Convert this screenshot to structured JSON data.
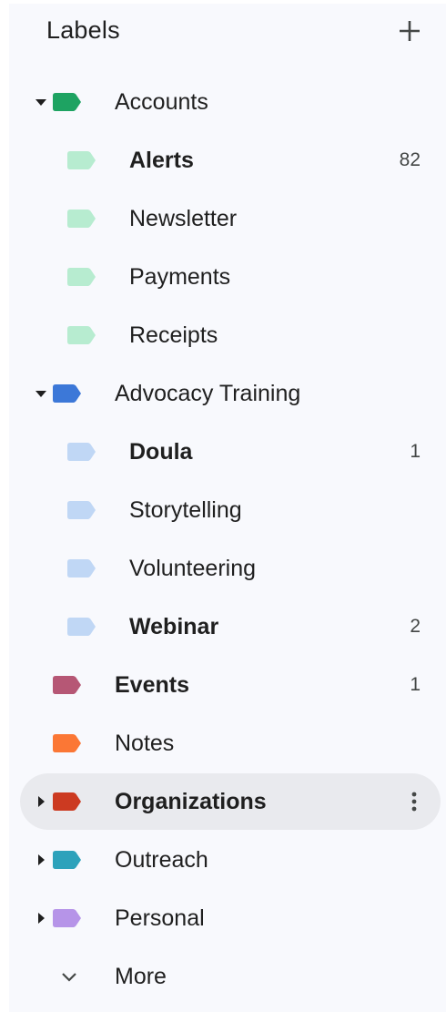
{
  "header": {
    "title": "Labels",
    "add_icon": "plus-icon"
  },
  "colors": {
    "green": "#1ea362",
    "light_green": "#b7ecd0",
    "blue": "#3c78d8",
    "light_blue": "#c0d7f5",
    "pink": "#b65775",
    "orange": "#fb7735",
    "red": "#cc3a21",
    "teal": "#2da2bb",
    "purple": "#b694e8"
  },
  "labels": [
    {
      "name": "Accounts",
      "color": "#1ea362",
      "caret": "down",
      "bold": false,
      "count": "",
      "level": 0
    },
    {
      "name": "Alerts",
      "color": "#b7ecd0",
      "caret": "",
      "bold": true,
      "count": "82",
      "level": 1
    },
    {
      "name": "Newsletter",
      "color": "#b7ecd0",
      "caret": "",
      "bold": false,
      "count": "",
      "level": 1
    },
    {
      "name": "Payments",
      "color": "#b7ecd0",
      "caret": "",
      "bold": false,
      "count": "",
      "level": 1
    },
    {
      "name": "Receipts",
      "color": "#b7ecd0",
      "caret": "",
      "bold": false,
      "count": "",
      "level": 1
    },
    {
      "name": "Advocacy Training",
      "color": "#3c78d8",
      "caret": "down",
      "bold": false,
      "count": "",
      "level": 0
    },
    {
      "name": "Doula",
      "color": "#c0d7f5",
      "caret": "",
      "bold": true,
      "count": "1",
      "level": 1
    },
    {
      "name": "Storytelling",
      "color": "#c0d7f5",
      "caret": "",
      "bold": false,
      "count": "",
      "level": 1
    },
    {
      "name": "Volunteering",
      "color": "#c0d7f5",
      "caret": "",
      "bold": false,
      "count": "",
      "level": 1
    },
    {
      "name": "Webinar",
      "color": "#c0d7f5",
      "caret": "",
      "bold": true,
      "count": "2",
      "level": 1
    },
    {
      "name": "Events",
      "color": "#b65775",
      "caret": "",
      "bold": true,
      "count": "1",
      "level": 0
    },
    {
      "name": "Notes",
      "color": "#fb7735",
      "caret": "",
      "bold": false,
      "count": "",
      "level": 0
    },
    {
      "name": "Organizations",
      "color": "#cc3a21",
      "caret": "right",
      "bold": true,
      "count": "",
      "level": 0,
      "active": true,
      "menu_icon": "more-vert-icon"
    },
    {
      "name": "Outreach",
      "color": "#2da2bb",
      "caret": "right",
      "bold": false,
      "count": "",
      "level": 0
    },
    {
      "name": "Personal",
      "color": "#b694e8",
      "caret": "right",
      "bold": false,
      "count": "",
      "level": 0
    }
  ],
  "more": {
    "label": "More",
    "icon": "chevron-down-icon"
  }
}
